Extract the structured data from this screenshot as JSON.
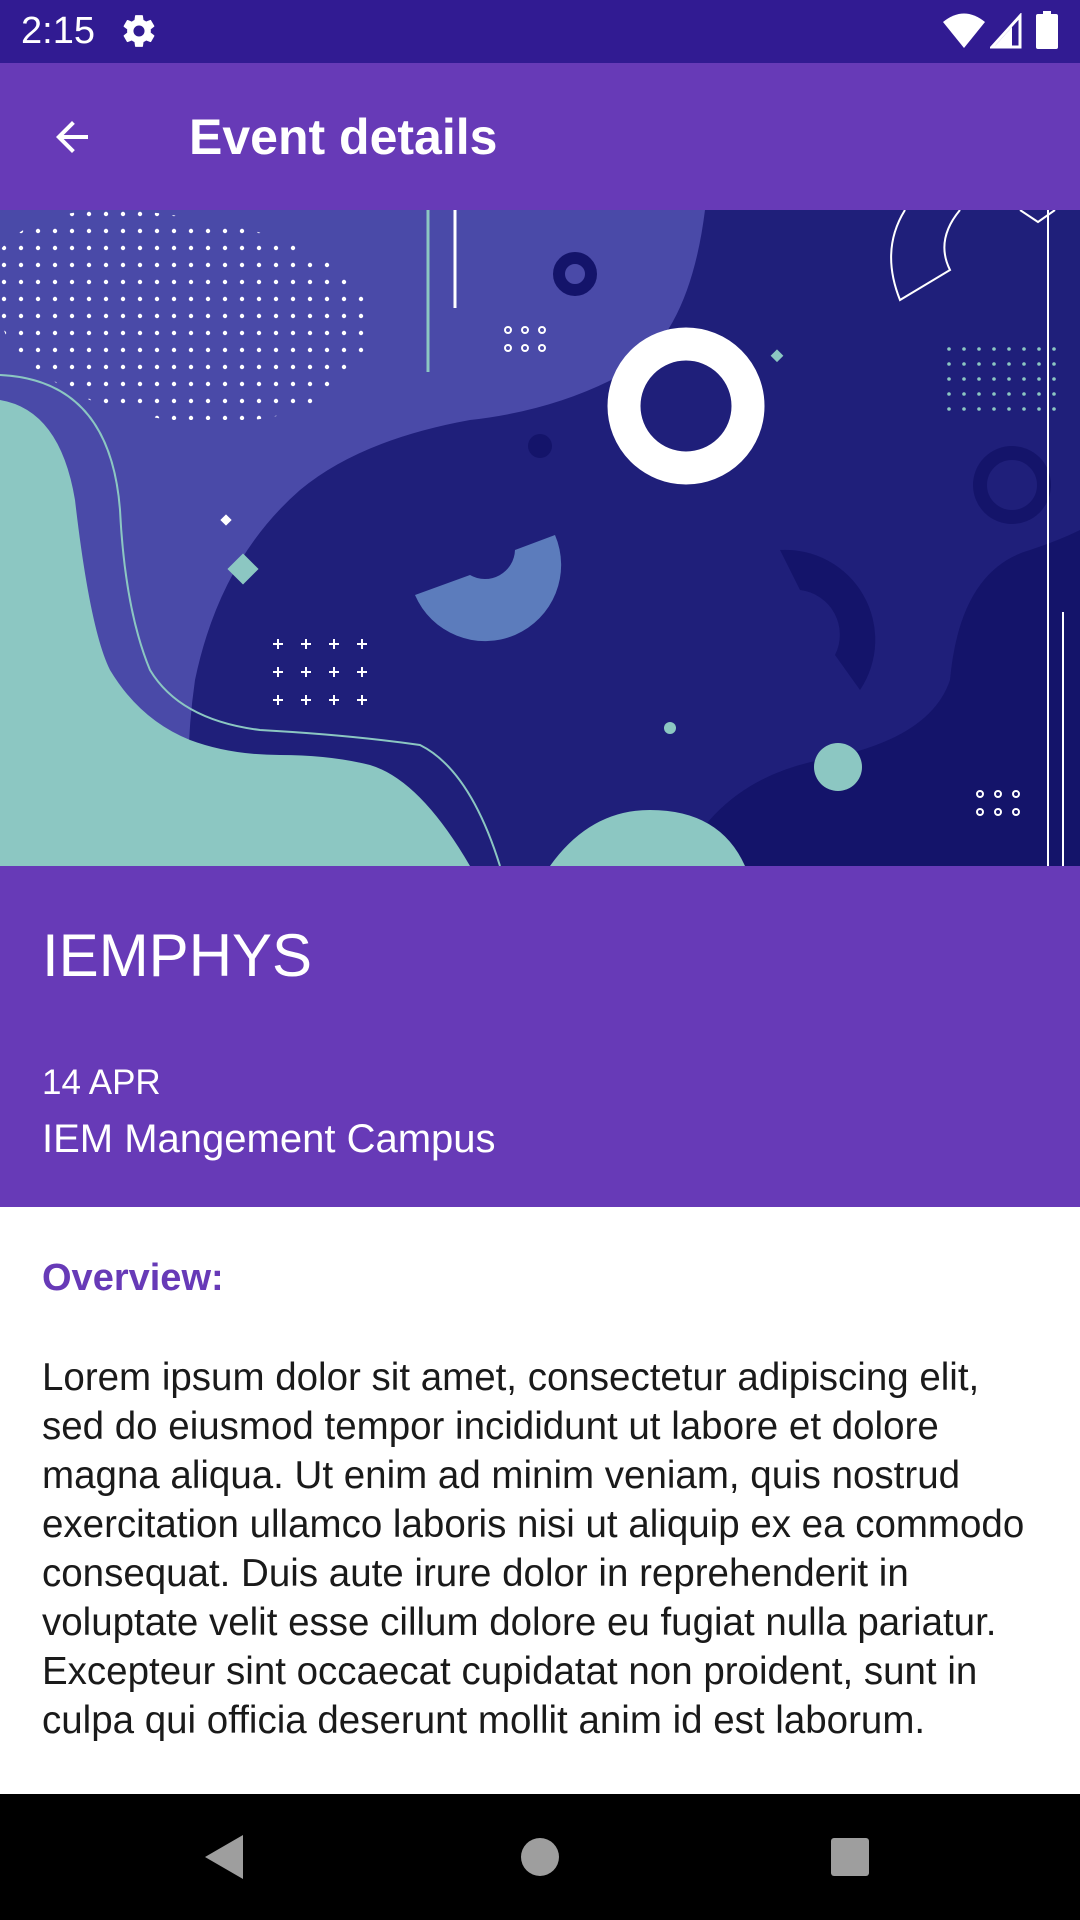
{
  "status_bar": {
    "time": "2:15",
    "icons": [
      "gear-icon",
      "wifi-icon",
      "signal-icon",
      "battery-icon"
    ]
  },
  "app_bar": {
    "title": "Event details",
    "back_icon": "arrow-back-icon"
  },
  "event": {
    "name": "IEMPHYS",
    "date": "14 APR",
    "venue": "IEM Mangement Campus"
  },
  "overview": {
    "label": "Overview:",
    "text": "Lorem ipsum dolor sit amet, consectetur adipiscing elit, sed do eiusmod tempor incididunt ut labore et dolore magna aliqua. Ut enim ad minim veniam, quis nostrud exercitation ullamco laboris nisi ut aliquip ex ea commodo consequat. Duis aute irure dolor in reprehenderit in voluptate velit esse cillum dolore eu fugiat nulla pariatur. Excepteur sint occaecat cupidatat non proident, sunt in culpa qui officia deserunt mollit anim id est laborum."
  },
  "nav_bar": {
    "buttons": [
      "back-triangle-icon",
      "home-circle-icon",
      "recents-square-icon"
    ]
  },
  "colors": {
    "status_bar": "#311b92",
    "primary": "#673ab7",
    "banner_navy": "#1f1f7a",
    "banner_teal": "#8cc7c2",
    "nav_bar": "#000000"
  }
}
